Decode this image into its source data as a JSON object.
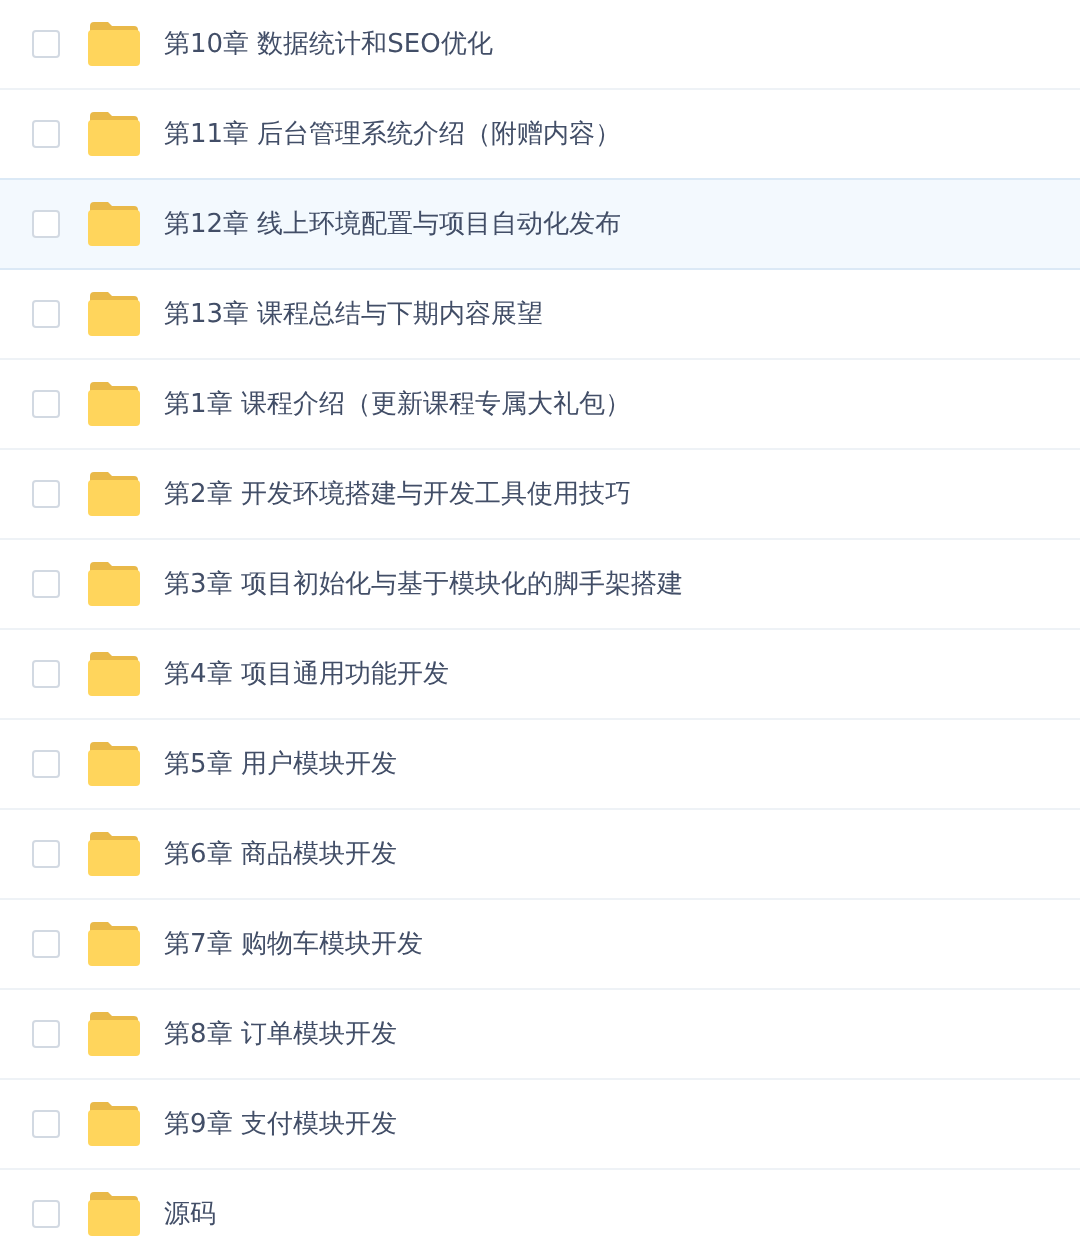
{
  "files": [
    {
      "name": "第10章 数据统计和SEO优化",
      "checked": false,
      "highlighted": false
    },
    {
      "name": "第11章 后台管理系统介绍（附赠内容）",
      "checked": false,
      "highlighted": false
    },
    {
      "name": "第12章 线上环境配置与项目自动化发布",
      "checked": false,
      "highlighted": true
    },
    {
      "name": "第13章 课程总结与下期内容展望",
      "checked": false,
      "highlighted": false
    },
    {
      "name": "第1章 课程介绍（更新课程专属大礼包）",
      "checked": false,
      "highlighted": false
    },
    {
      "name": "第2章 开发环境搭建与开发工具使用技巧",
      "checked": false,
      "highlighted": false
    },
    {
      "name": "第3章 项目初始化与基于模块化的脚手架搭建",
      "checked": false,
      "highlighted": false
    },
    {
      "name": "第4章 项目通用功能开发",
      "checked": false,
      "highlighted": false
    },
    {
      "name": "第5章 用户模块开发",
      "checked": false,
      "highlighted": false
    },
    {
      "name": "第6章 商品模块开发",
      "checked": false,
      "highlighted": false
    },
    {
      "name": "第7章 购物车模块开发",
      "checked": false,
      "highlighted": false
    },
    {
      "name": "第8章 订单模块开发",
      "checked": false,
      "highlighted": false
    },
    {
      "name": "第9章 支付模块开发",
      "checked": false,
      "highlighted": false
    },
    {
      "name": "源码",
      "checked": false,
      "highlighted": false
    }
  ]
}
